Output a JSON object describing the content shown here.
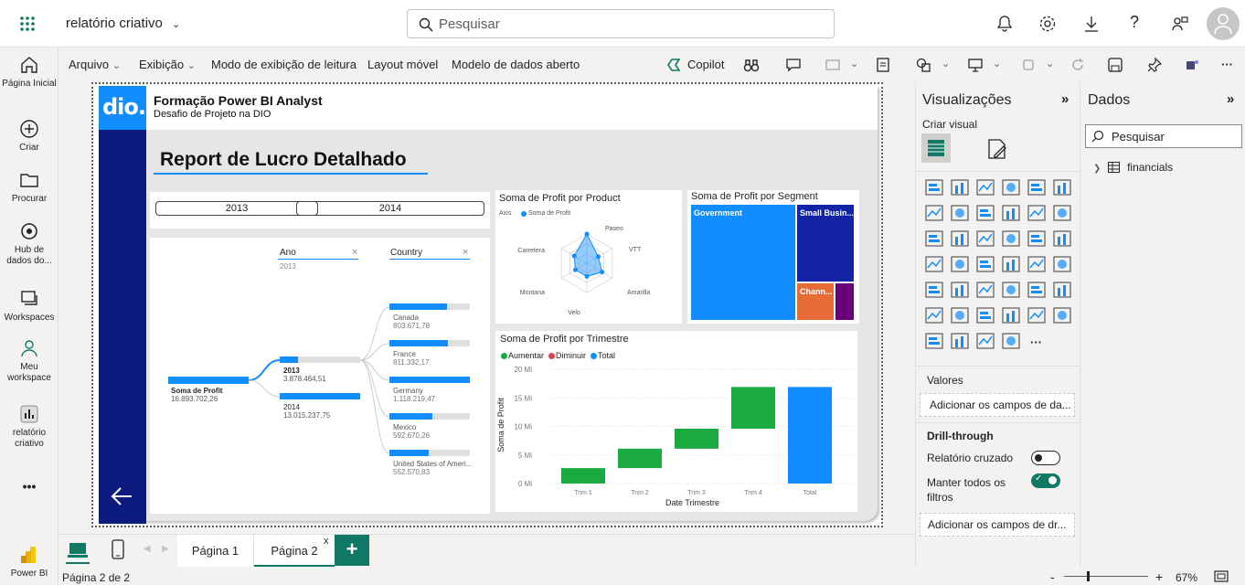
{
  "app": {
    "report_name": "relatório criativo",
    "search_placeholder": "Pesquisar",
    "brand": "Power BI"
  },
  "nav": [
    {
      "label": "Página Inicial",
      "icon": "home-icon"
    },
    {
      "label": "Criar",
      "icon": "plus-icon"
    },
    {
      "label": "Procurar",
      "icon": "folder-icon"
    },
    {
      "label": "Hub de dados do...",
      "icon": "data-hub-icon"
    },
    {
      "label": "Workspaces",
      "icon": "workspaces-icon"
    },
    {
      "label": "Meu workspace",
      "icon": "person-icon"
    },
    {
      "label": "relatório criativo",
      "icon": "report-icon"
    },
    {
      "label": "•••",
      "icon": "more-icon"
    }
  ],
  "ribbon": {
    "arquivo": "Arquivo",
    "exibicao": "Exibição",
    "leitura": "Modo de exibição de leitura",
    "movel": "Layout móvel",
    "modelo": "Modelo de dados aberto",
    "copilot": "Copilot"
  },
  "report": {
    "header_title": "Formação Power BI Analyst",
    "header_subtitle": "Desafio de Projeto na DIO",
    "logo": "dio.",
    "main_title": "Report de Lucro Detalhado",
    "slicer": [
      "2013",
      "2014"
    ],
    "decomp": {
      "root_label": "Soma de Profit",
      "root_value": "16.893.702,26",
      "col1_header": "Ano",
      "col1_filter": "2013",
      "col2_header": "Country",
      "years": [
        {
          "label": "2013",
          "value": "3.878.464,51",
          "fill": 0.23
        },
        {
          "label": "2014",
          "value": "13.015.237,75",
          "fill": 1.0
        }
      ],
      "countries": [
        {
          "label": "Canada",
          "value": "803.671,78",
          "fill": 0.72
        },
        {
          "label": "France",
          "value": "811.332,17",
          "fill": 0.73
        },
        {
          "label": "Germany",
          "value": "1.118.219,47",
          "fill": 1.0
        },
        {
          "label": "Mexico",
          "value": "592.670,26",
          "fill": 0.53
        },
        {
          "label": "United States of Ameri...",
          "value": "552.570,83",
          "fill": 0.49
        }
      ]
    },
    "radar": {
      "title": "Soma de Profit por Product",
      "legend_axis": "Axis",
      "legend_series": "Soma de Profit",
      "axes": [
        "Paseo",
        "VTT",
        "Amarilla",
        "Velo",
        "Montana",
        "Carretera"
      ]
    },
    "treemap": {
      "title": "Soma de Profit por Segment",
      "labels": [
        "Government",
        "Small Busin...",
        "Chann..."
      ]
    },
    "waterfall": {
      "title": "Soma de Profit por Trimestre",
      "legend": [
        "Aumentar",
        "Diminuir",
        "Total"
      ],
      "ylabel": "Soma de Profit",
      "xlabel": "Date Trimestre",
      "yticks": [
        "20 Mi",
        "15 Mi",
        "10 Mi",
        "5 Mi",
        "0 Mi"
      ]
    }
  },
  "chart_data": {
    "type": "bar",
    "title": "Soma de Profit por Trimestre",
    "xlabel": "Date Trimestre",
    "ylabel": "Soma de Profit",
    "categories": [
      "Trim 1",
      "Trim 2",
      "Trim 3",
      "Trim 4",
      "Total"
    ],
    "series": [
      {
        "name": "Aumentar",
        "start": [
          0,
          2.7,
          6.1,
          9.6,
          0
        ],
        "end": [
          2.7,
          6.1,
          9.6,
          16.9,
          16.9
        ]
      }
    ],
    "ylim": [
      0,
      20
    ],
    "colors": {
      "increase": "#1aab40",
      "decrease": "#d64550",
      "total": "#118dff"
    }
  },
  "tabs": {
    "page1": "Página 1",
    "page2": "Página 2",
    "close": "x",
    "add": "+"
  },
  "status": {
    "page": "Página 2 de 2",
    "zoom": "67%",
    "minus": "-",
    "plus": "+"
  },
  "viz": {
    "title": "Visualizações",
    "expand": "»",
    "build": "Criar visual",
    "values": "Valores",
    "add_fields": "Adicionar os campos de da...",
    "drill": "Drill-through",
    "cross_report": "Relatório cruzado",
    "keep_filters": "Manter todos os filtros",
    "add_drill": "Adicionar os campos de dr...",
    "more": "···"
  },
  "data_pane": {
    "title": "Dados",
    "expand": "»",
    "search": "Pesquisar",
    "table": "financials"
  },
  "colors": {
    "accent": "#117865",
    "brand_blue": "#0e1b7e",
    "pbi_blue": "#118dff"
  }
}
